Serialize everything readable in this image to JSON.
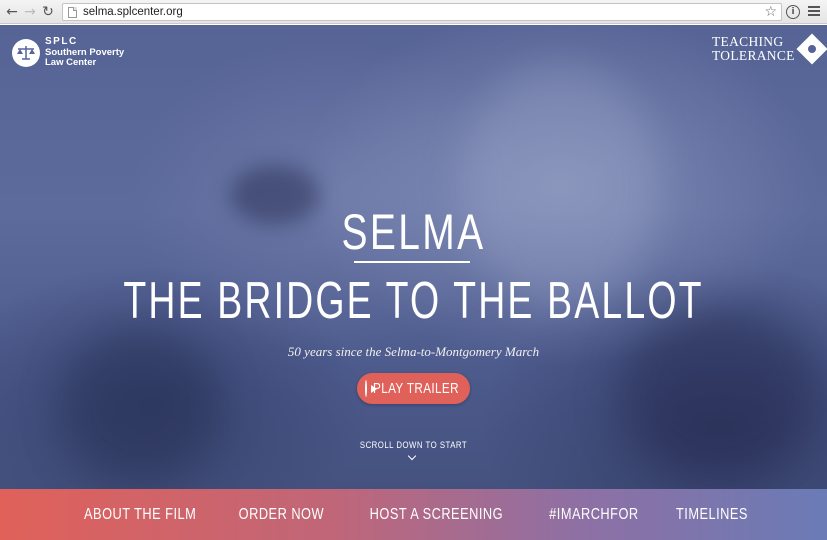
{
  "browser": {
    "url": "selma.splcenter.org",
    "back_icon": "back-arrow-icon",
    "forward_icon": "forward-arrow-icon",
    "reload_icon": "reload-icon"
  },
  "header": {
    "splc_abbr": "SPLC",
    "splc_line1": "Southern Poverty",
    "splc_line2": "Law Center",
    "tt_line1": "TEACHING",
    "tt_line2": "TOLERANCE"
  },
  "hero": {
    "title": "SELMA",
    "subtitle_main": "THE BRIDGE TO THE BALLOT",
    "tagline": "50 years since the Selma-to-Montgomery March",
    "play_label": "PLAY TRAILER",
    "scroll_label": "SCROLL DOWN TO START"
  },
  "nav": {
    "items": [
      "ABOUT THE FILM",
      "ORDER NOW",
      "HOST A SCREENING",
      "#IMARCHFOR",
      "TIMELINES"
    ]
  },
  "colors": {
    "accent": "#e0615a",
    "hero_blue": "#566395",
    "nav_gradient_end": "#6a7bb6"
  }
}
